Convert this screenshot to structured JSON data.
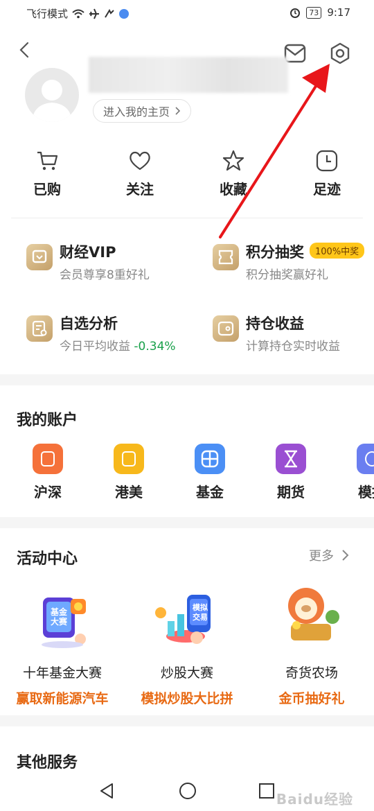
{
  "status_bar": {
    "left_text": "飞行模式",
    "battery": "73",
    "time": "9:17"
  },
  "profile": {
    "home_link": "进入我的主页"
  },
  "quick_actions": [
    {
      "label": "已购",
      "icon": "cart-icon"
    },
    {
      "label": "关注",
      "icon": "heart-icon"
    },
    {
      "label": "收藏",
      "icon": "star-icon"
    },
    {
      "label": "足迹",
      "icon": "clock-icon"
    }
  ],
  "features": [
    {
      "title": "财经VIP",
      "subtitle": "会员尊享8重好礼",
      "icon": "vip-icon"
    },
    {
      "title": "积分抽奖",
      "subtitle": "积分抽奖赢好礼",
      "badge": "100%中奖",
      "icon": "lottery-icon"
    },
    {
      "title": "自选分析",
      "subtitle_prefix": "今日平均收益 ",
      "subtitle_value": "-0.34%",
      "icon": "analysis-icon"
    },
    {
      "title": "持仓收益",
      "subtitle": "计算持仓实时收益",
      "icon": "wallet-icon"
    }
  ],
  "accounts": {
    "title": "我的账户",
    "items": [
      {
        "label": "沪深",
        "color": "#f5713a"
      },
      {
        "label": "港美",
        "color": "#f7b81b"
      },
      {
        "label": "基金",
        "color": "#4b8ff5"
      },
      {
        "label": "期货",
        "color": "#9a4fd2"
      },
      {
        "label": "模拟",
        "color": "#6a7ef0"
      }
    ]
  },
  "activity": {
    "title": "活动中心",
    "more": "更多",
    "items": [
      {
        "title": "十年基金大赛",
        "subtitle": "赢取新能源汽车",
        "pic_text": "基金大赛"
      },
      {
        "title": "炒股大赛",
        "subtitle": "模拟炒股大比拼",
        "pic_text": "模拟交易"
      },
      {
        "title": "奇货农场",
        "subtitle": "金币抽好礼"
      }
    ]
  },
  "services": {
    "title": "其他服务"
  },
  "watermark": "Baidu经验",
  "colors": {
    "accent_orange": "#e86a14",
    "badge_yellow": "#ffc619",
    "gain_green": "#18a04a",
    "arrow_red": "#e8161a"
  }
}
